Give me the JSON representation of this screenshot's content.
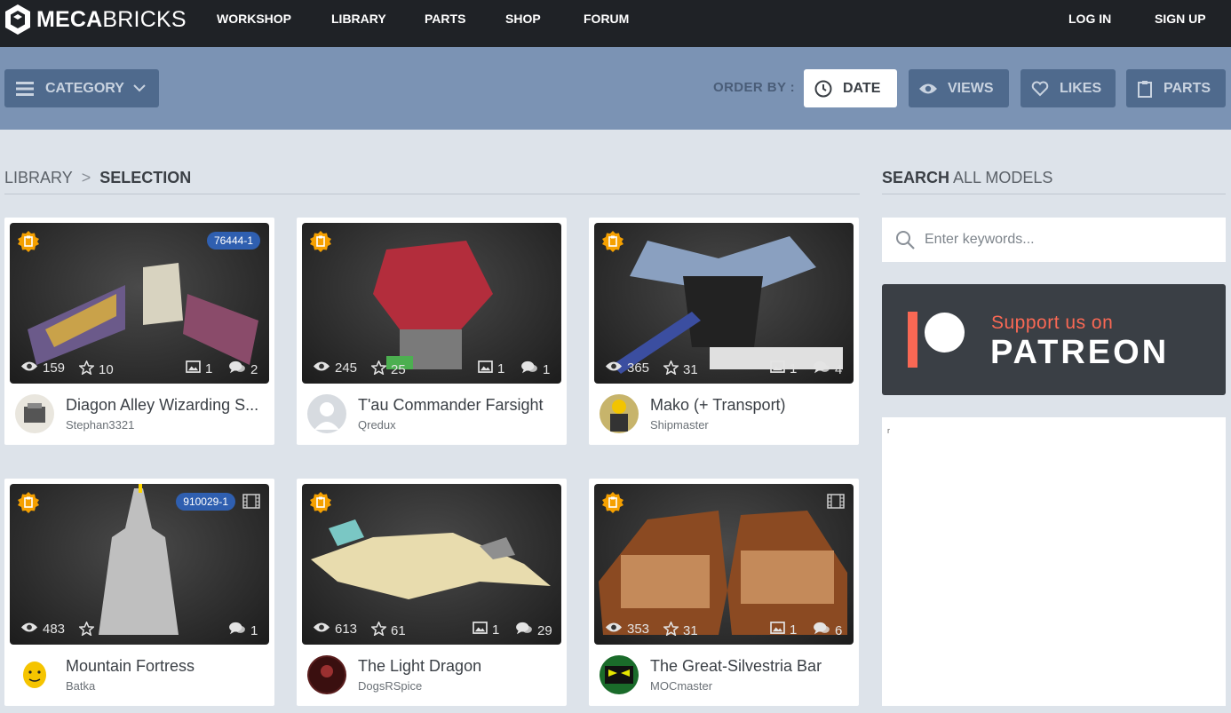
{
  "brand": {
    "bold": "MECA",
    "rest": "BRICKS"
  },
  "nav": {
    "workshop": "WORKSHOP",
    "library": "LIBRARY",
    "parts": "PARTS",
    "shop": "SHOP",
    "forum": "FORUM",
    "login": "LOG IN",
    "signup": "SIGN UP"
  },
  "filters": {
    "category": "CATEGORY",
    "order_by": "ORDER BY :",
    "date": "DATE",
    "views": "VIEWS",
    "likes": "LIKES",
    "parts": "PARTS",
    "active": "DATE"
  },
  "breadcrumb": {
    "root": "LIBRARY",
    "current": "SELECTION"
  },
  "search": {
    "label_bold": "SEARCH",
    "label_rest": "ALL MODELS",
    "placeholder": "Enter keywords..."
  },
  "patreon": {
    "line1": "Support us on",
    "line2": "PATREON"
  },
  "ad": {
    "mark": "r"
  },
  "models": [
    {
      "title": "Diagon Alley Wizarding S...",
      "author": "Stephan3321",
      "views": "159",
      "stars": "10",
      "images": "1",
      "comments": "2",
      "set_id": "76444-1",
      "has_video": false
    },
    {
      "title": "T'au Commander Farsight",
      "author": "Qredux",
      "views": "245",
      "stars": "25",
      "images": "1",
      "comments": "1",
      "set_id": "",
      "has_video": false
    },
    {
      "title": "Mako (+ Transport)",
      "author": "Shipmaster",
      "views": "365",
      "stars": "31",
      "images": "1",
      "comments": "4",
      "set_id": "",
      "has_video": false
    },
    {
      "title": "Mountain Fortress",
      "author": "Batka",
      "views": "483",
      "stars": "",
      "images": "",
      "comments": "1",
      "set_id": "910029-1",
      "has_video": true
    },
    {
      "title": "The Light Dragon",
      "author": "DogsRSpice",
      "views": "613",
      "stars": "61",
      "images": "1",
      "comments": "29",
      "set_id": "",
      "has_video": false
    },
    {
      "title": "The Great-Silvestria Bar",
      "author": "MOCmaster",
      "views": "353",
      "stars": "31",
      "images": "1",
      "comments": "6",
      "set_id": "",
      "has_video": true
    }
  ],
  "colors": {
    "topbar": "#1f2226",
    "filterbar": "#7b93b4",
    "button": "#4f6a8d",
    "page": "#dde3ea",
    "set_badge": "#2f5fb0",
    "featured_badge": "#f5a000",
    "patreon_accent": "#f96854"
  }
}
